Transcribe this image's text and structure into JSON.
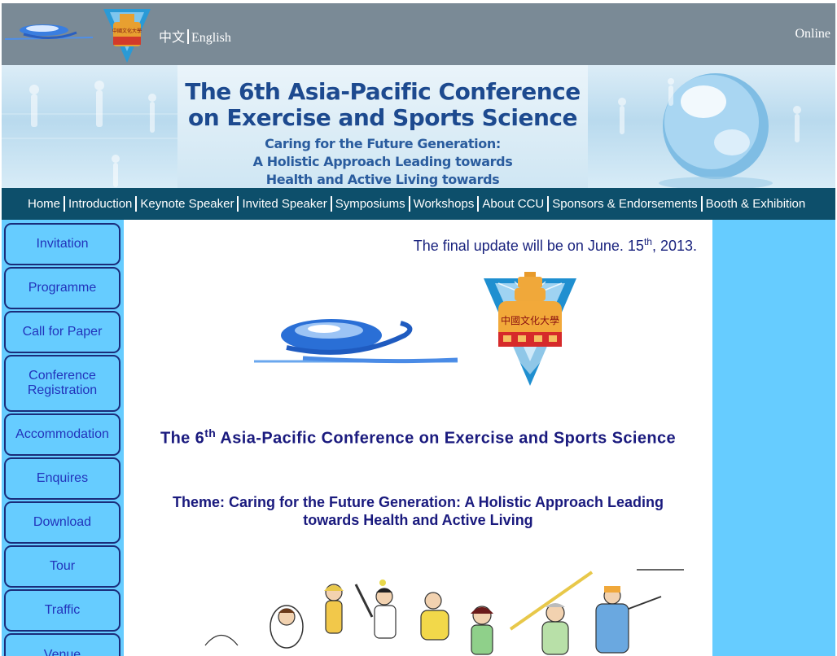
{
  "header": {
    "lang_zh": "中文",
    "lang_en": "English",
    "online": "Online",
    "emblem_text": "中國文化大學"
  },
  "banner": {
    "title_line1": "The 6th Asia-Pacific Conference",
    "title_line2": "on Exercise and Sports Science",
    "subtitle_line1": "Caring for the Future Generation:",
    "subtitle_line2": "A Holistic Approach Leading towards",
    "subtitle_line3": "Health and Active Living towards"
  },
  "nav": {
    "items": [
      {
        "label": "Home"
      },
      {
        "label": "Introduction"
      },
      {
        "label": "Keynote Speaker"
      },
      {
        "label": "Invited Speaker"
      },
      {
        "label": "Symposiums"
      },
      {
        "label": "Workshops"
      },
      {
        "label": "About CCU"
      },
      {
        "label": "Sponsors & Endorsements"
      },
      {
        "label": "Booth & Exhibition"
      }
    ]
  },
  "sidebar": {
    "items": [
      {
        "label": "Invitation"
      },
      {
        "label": "Programme"
      },
      {
        "label": "Call for Paper"
      },
      {
        "label": "Conference Registration"
      },
      {
        "label": "Accommodation"
      },
      {
        "label": "Enquires"
      },
      {
        "label": "Download"
      },
      {
        "label": "Tour"
      },
      {
        "label": "Traffic"
      },
      {
        "label": "Venue"
      }
    ]
  },
  "main": {
    "update_prefix": "The final update will be on June. 15",
    "update_sup": "th",
    "update_suffix": ", 2013.",
    "title_prefix": "The 6",
    "title_sup": "th",
    "title_suffix": " Asia-Pacific Conference on Exercise and Sports Science",
    "theme": "Theme: Caring for the Future Generation: A Holistic Approach Leading towards Health and Active Living"
  },
  "colors": {
    "topbar": "#7a8a96",
    "nav": "#0d4f6b",
    "sidebar": "#66ccff",
    "sidebar_text": "#2233bb",
    "heading": "#1a1a7e"
  }
}
